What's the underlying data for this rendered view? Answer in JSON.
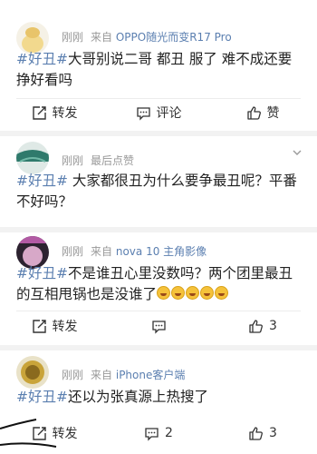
{
  "posts": [
    {
      "time": "刚刚",
      "source_prefix": "来自",
      "source": "OPPO随光而变R17 Pro",
      "tag": "#好丑#",
      "text": "大哥别说二哥 都丑 服了 难不成还要挣好看吗",
      "repost_label": "转发",
      "comment_label": "评论",
      "like_label": "赞"
    },
    {
      "time": "刚刚",
      "source": "最后点赞",
      "tag": "#好丑#",
      "text": " 大家都很丑为什么要争最丑呢？平番不好吗？"
    },
    {
      "time": "刚刚",
      "source_prefix": "来自",
      "source": "nova 10 主角影像",
      "tag": "#好丑#",
      "text": "不是谁丑心里没数吗？两个团里最丑的互相甩锅也是没谁了",
      "emoji_count": 5,
      "repost_label": "转发",
      "like_count": "3"
    },
    {
      "time": "刚刚",
      "source_prefix": "来自",
      "source": "iPhone客户端",
      "tag": "#好丑#",
      "text": "还以为张真源上热搜了",
      "repost_label": "转发",
      "comment_count": "2",
      "like_count": "3"
    }
  ],
  "colors": {
    "accent": "#5b7fb0",
    "meta": "#999999",
    "background": "#f2f2f2"
  },
  "icons": [
    "chevron-down-icon",
    "repost-icon",
    "comment-icon",
    "like-icon",
    "avatar"
  ]
}
